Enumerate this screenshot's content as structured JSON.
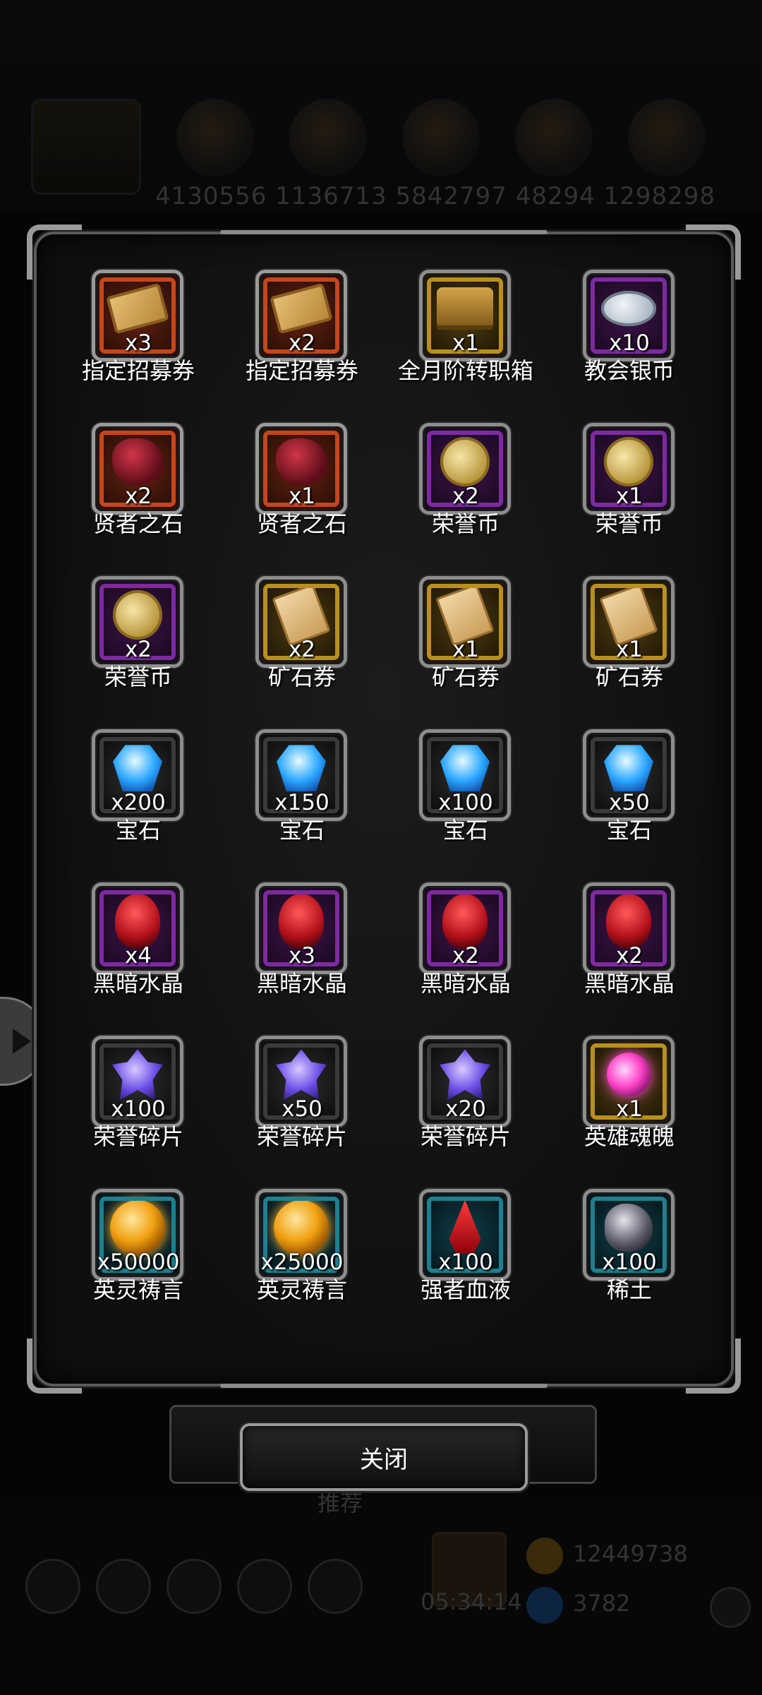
{
  "background": {
    "resource_values": "4130556  1136713  5842797  48294  1298298",
    "timer": "05:34:14",
    "gold": "12449738",
    "gems": "3782",
    "bottom_label": "推荐"
  },
  "items": [
    {
      "qty": "x3",
      "name": "指定招募券",
      "quality": "red",
      "icon": "scroll-icon"
    },
    {
      "qty": "x2",
      "name": "指定招募券",
      "quality": "red",
      "icon": "scroll-icon"
    },
    {
      "qty": "x1",
      "name": "全月阶转职箱",
      "quality": "gold",
      "icon": "chest-icon"
    },
    {
      "qty": "x10",
      "name": "教会银币",
      "quality": "purple",
      "icon": "silver-coin-icon"
    },
    {
      "qty": "x2",
      "name": "贤者之石",
      "quality": "red",
      "icon": "sage-stone-icon"
    },
    {
      "qty": "x1",
      "name": "贤者之石",
      "quality": "red",
      "icon": "sage-stone-icon"
    },
    {
      "qty": "x2",
      "name": "荣誉币",
      "quality": "purple",
      "icon": "honor-coin-icon"
    },
    {
      "qty": "x1",
      "name": "荣誉币",
      "quality": "purple",
      "icon": "honor-coin-icon"
    },
    {
      "qty": "x2",
      "name": "荣誉币",
      "quality": "purple",
      "icon": "honor-coin-icon"
    },
    {
      "qty": "x2",
      "name": "矿石券",
      "quality": "gold",
      "icon": "ore-ticket-icon"
    },
    {
      "qty": "x1",
      "name": "矿石券",
      "quality": "gold",
      "icon": "ore-ticket-icon"
    },
    {
      "qty": "x1",
      "name": "矿石券",
      "quality": "gold",
      "icon": "ore-ticket-icon"
    },
    {
      "qty": "x200",
      "name": "宝石",
      "quality": "gray",
      "icon": "gem-icon"
    },
    {
      "qty": "x150",
      "name": "宝石",
      "quality": "gray",
      "icon": "gem-icon"
    },
    {
      "qty": "x100",
      "name": "宝石",
      "quality": "gray",
      "icon": "gem-icon"
    },
    {
      "qty": "x50",
      "name": "宝石",
      "quality": "gray",
      "icon": "gem-icon"
    },
    {
      "qty": "x4",
      "name": "黑暗水晶",
      "quality": "purple",
      "icon": "dark-crystal-icon"
    },
    {
      "qty": "x3",
      "name": "黑暗水晶",
      "quality": "purple",
      "icon": "dark-crystal-icon"
    },
    {
      "qty": "x2",
      "name": "黑暗水晶",
      "quality": "purple",
      "icon": "dark-crystal-icon"
    },
    {
      "qty": "x2",
      "name": "黑暗水晶",
      "quality": "purple",
      "icon": "dark-crystal-icon"
    },
    {
      "qty": "x100",
      "name": "荣誉碎片",
      "quality": "gray",
      "icon": "honor-shard-icon"
    },
    {
      "qty": "x50",
      "name": "荣誉碎片",
      "quality": "gray",
      "icon": "honor-shard-icon"
    },
    {
      "qty": "x20",
      "name": "荣誉碎片",
      "quality": "gray",
      "icon": "honor-shard-icon"
    },
    {
      "qty": "x1",
      "name": "英雄魂魄",
      "quality": "gold",
      "icon": "hero-soul-icon"
    },
    {
      "qty": "x50000",
      "name": "英灵祷言",
      "quality": "teal",
      "icon": "spirit-prayer-icon"
    },
    {
      "qty": "x25000",
      "name": "英灵祷言",
      "quality": "teal",
      "icon": "spirit-prayer-icon"
    },
    {
      "qty": "x100",
      "name": "强者血液",
      "quality": "teal",
      "icon": "strong-blood-icon"
    },
    {
      "qty": "x100",
      "name": "稀土",
      "quality": "teal",
      "icon": "rare-earth-icon"
    }
  ],
  "close_button": {
    "label": "关闭"
  }
}
